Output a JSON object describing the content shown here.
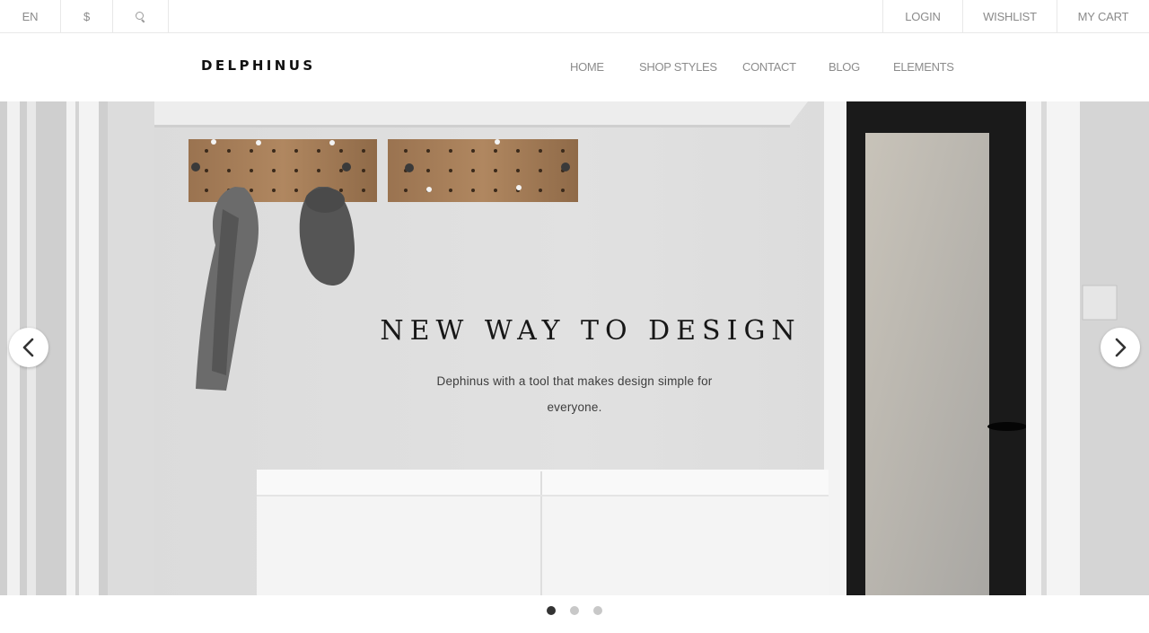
{
  "topbar": {
    "language": "EN",
    "currency": "$",
    "search_icon": "search-icon",
    "login": "LOGIN",
    "wishlist": "WISHLIST",
    "cart": "MY CART"
  },
  "header": {
    "logo": "DELPHINUS",
    "nav": [
      "HOME",
      "SHOP STYLES",
      "CONTACT",
      "BLOG",
      "ELEMENTS"
    ]
  },
  "hero": {
    "title": "NEW WAY TO DESIGN",
    "subtitle": "Dephinus with a tool that makes design simple for everyone.",
    "prev_icon": "chevron-left-icon",
    "next_icon": "chevron-right-icon"
  },
  "slider": {
    "slide_count": 3,
    "active_index": 0
  },
  "colors": {
    "accent_text": "#171717",
    "muted_text": "#8c8c8c",
    "dot_active": "#333333",
    "dot_inactive": "#c8c8c8"
  }
}
